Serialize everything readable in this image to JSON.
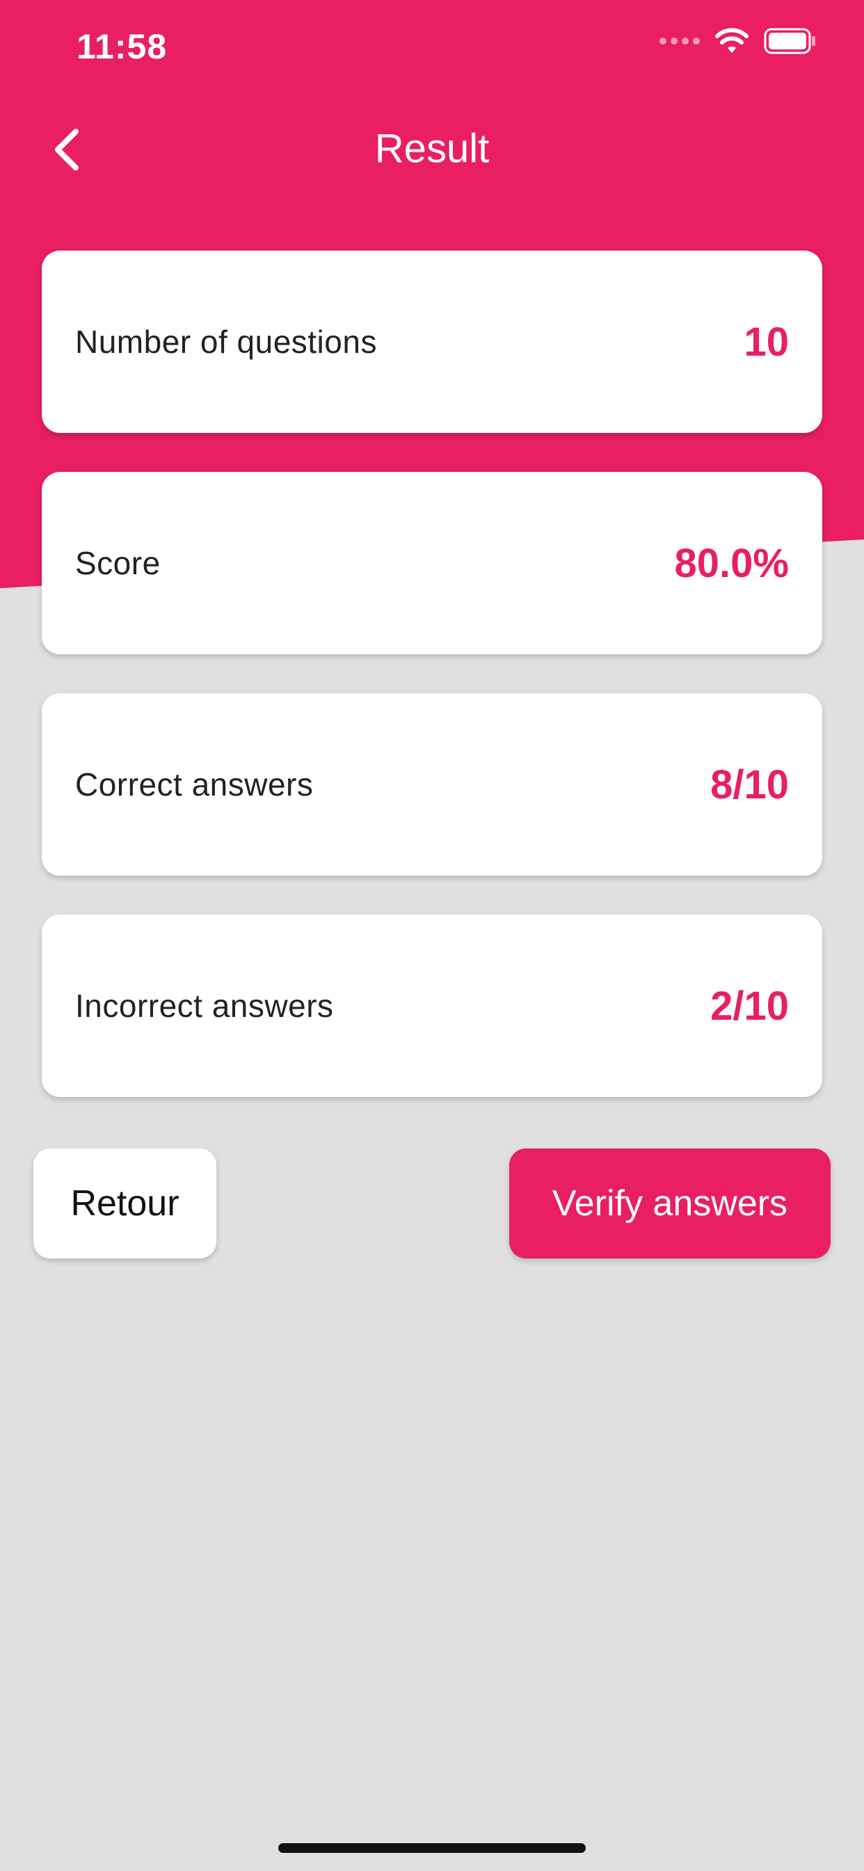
{
  "status_bar": {
    "time": "11:58"
  },
  "nav": {
    "title": "Result"
  },
  "results": [
    {
      "label": "Number of questions",
      "value": "10"
    },
    {
      "label": "Score",
      "value": "80.0%"
    },
    {
      "label": "Correct answers",
      "value": "8/10"
    },
    {
      "label": "Incorrect answers",
      "value": "2/10"
    }
  ],
  "actions": {
    "back_label": "Retour",
    "verify_label": "Verify answers"
  },
  "colors": {
    "accent": "#e91e63",
    "background": "#e0e0e0",
    "card": "#ffffff"
  },
  "icons": {
    "back": "chevron-left-icon",
    "wifi": "wifi-icon",
    "battery": "battery-icon",
    "signal": "signal-icon"
  }
}
